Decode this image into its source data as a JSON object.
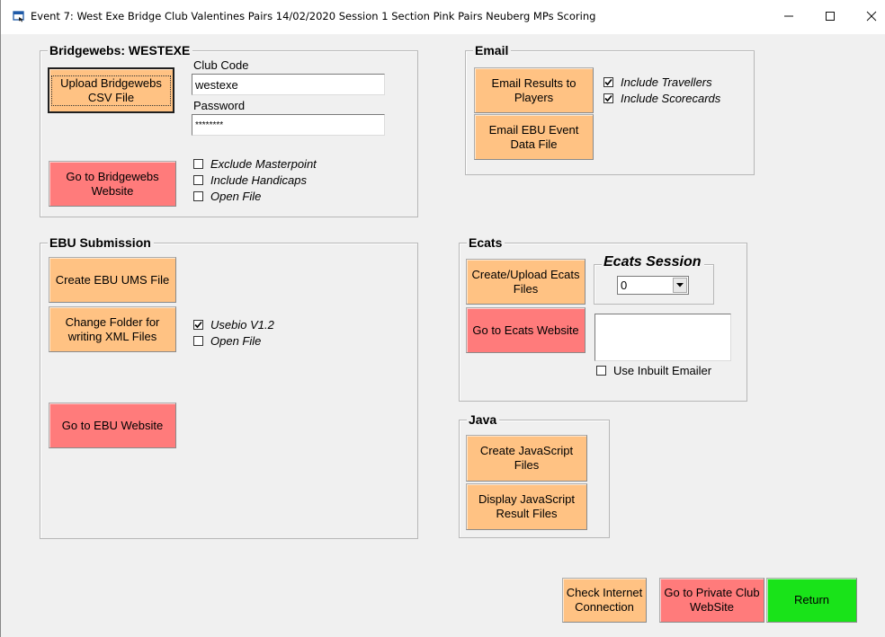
{
  "window": {
    "title": "Event 7: West Exe Bridge Club Valentines Pairs 14/02/2020 Session 1 Section Pink Pairs Neuberg MPs Scoring",
    "minimize": "–",
    "maximize": "☐",
    "close": "✕"
  },
  "bridgewebs": {
    "legend": "Bridgewebs: WESTEXE",
    "upload_button": "Upload Bridgewebs CSV File",
    "club_code_label": "Club Code",
    "club_code_value": "westexe",
    "password_label": "Password",
    "password_value": "********",
    "goto_button": "Go to Bridgewebs Website",
    "checkboxes": [
      {
        "label": "Exclude Masterpoint",
        "checked": false
      },
      {
        "label": "Include Handicaps",
        "checked": false
      },
      {
        "label": "Open File",
        "checked": false
      }
    ]
  },
  "email": {
    "legend": "Email",
    "email_results_button": "Email Results to Players",
    "email_ebu_button": "Email EBU Event Data File",
    "checkboxes": [
      {
        "label": "Include Travellers",
        "checked": true
      },
      {
        "label": "Include Scorecards",
        "checked": true
      }
    ]
  },
  "ebu": {
    "legend": "EBU Submission",
    "create_ums_button": "Create EBU UMS File",
    "change_folder_button": "Change Folder for writing XML Files",
    "goto_button": "Go to EBU Website",
    "checkboxes": [
      {
        "label": "Usebio V1.2",
        "checked": true
      },
      {
        "label": "Open File",
        "checked": false
      }
    ]
  },
  "ecats": {
    "legend": "Ecats",
    "create_upload_button": "Create/Upload Ecats Files",
    "goto_button": "Go to Ecats Website",
    "session_legend": "Ecats Session",
    "session_value": "0",
    "inbuilt_emailer_label": "Use Inbuilt Emailer",
    "inbuilt_emailer_checked": false
  },
  "java": {
    "legend": "Java",
    "create_js_button": "Create JavaScript Files",
    "display_js_button": "Display JavaScript Result Files"
  },
  "footer": {
    "check_internet_button": "Check Internet Connection",
    "private_club_button": "Go to Private Club WebSite",
    "return_button": "Return"
  },
  "colors": {
    "orange_button": "#ffc283",
    "red_button": "#ff7b7b",
    "green_button": "#19e319",
    "background": "#f0f0f0"
  }
}
